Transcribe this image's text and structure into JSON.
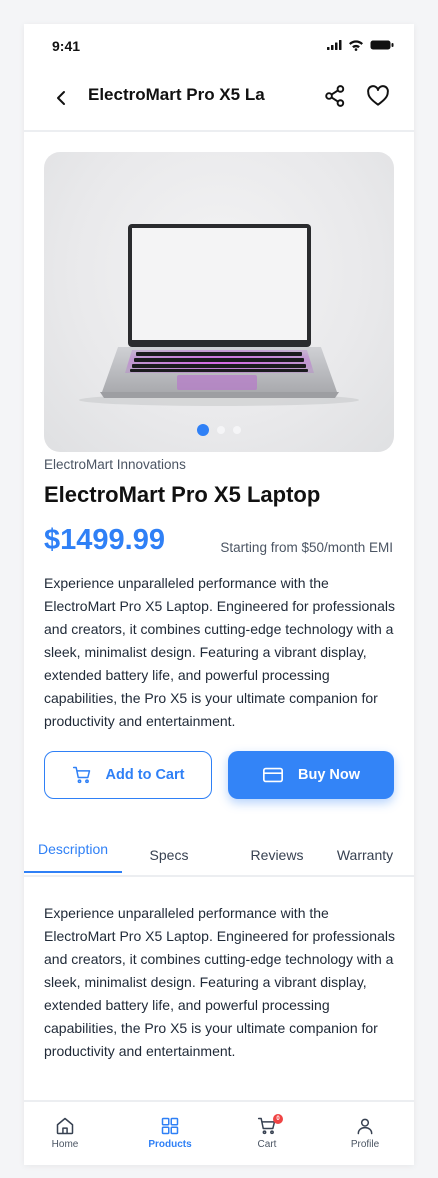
{
  "status_bar": {
    "time": "9:41",
    "icons": [
      "signal-icon",
      "wifi-icon",
      "battery-icon"
    ]
  },
  "header": {
    "title": "ElectroMart Pro X5 La",
    "back_icon": "chevron-left-icon",
    "share_icon": "share-icon",
    "favorite_icon": "heart-icon"
  },
  "gallery": {
    "slide_count": 3,
    "active_slide": 1
  },
  "product": {
    "brand": "ElectroMart Innovations",
    "name": "ElectroMart Pro X5 Laptop",
    "price": "$1499.99",
    "emi": "Starting from $50/month EMI",
    "description": "Experience unparalleled performance with the ElectroMart Pro X5 Laptop. Engineered for professionals and creators, it combines cutting-edge technology with a sleek, minimalist design. Featuring a vibrant display, extended battery life, and powerful processing capabilities, the Pro X5 is your ultimate companion for productivity and entertainment."
  },
  "actions": {
    "add_to_cart": "Add to Cart",
    "buy_now": "Buy Now"
  },
  "tabs": [
    {
      "label": "Description",
      "active": true
    },
    {
      "label": "Specs",
      "active": false
    },
    {
      "label": "Reviews",
      "active": false
    },
    {
      "label": "Warranty",
      "active": false
    }
  ],
  "tab_content": "Experience unparalleled performance with the ElectroMart Pro X5 Laptop. Engineered for professionals and creators, it combines cutting-edge technology with a sleek, minimalist design. Featuring a vibrant display, extended battery life, and powerful processing capabilities, the Pro X5 is your ultimate companion for productivity and entertainment.",
  "bottom_nav": [
    {
      "label": "Home",
      "icon": "home-icon",
      "active": false
    },
    {
      "label": "Products",
      "icon": "grid-icon",
      "active": true
    },
    {
      "label": "Cart",
      "icon": "cart-icon",
      "active": false,
      "badge": "0"
    },
    {
      "label": "Profile",
      "icon": "user-icon",
      "active": false
    }
  ],
  "colors": {
    "accent": "#2f80f6",
    "badge": "#ef4444",
    "text": "#111827",
    "muted": "#4b5563"
  }
}
